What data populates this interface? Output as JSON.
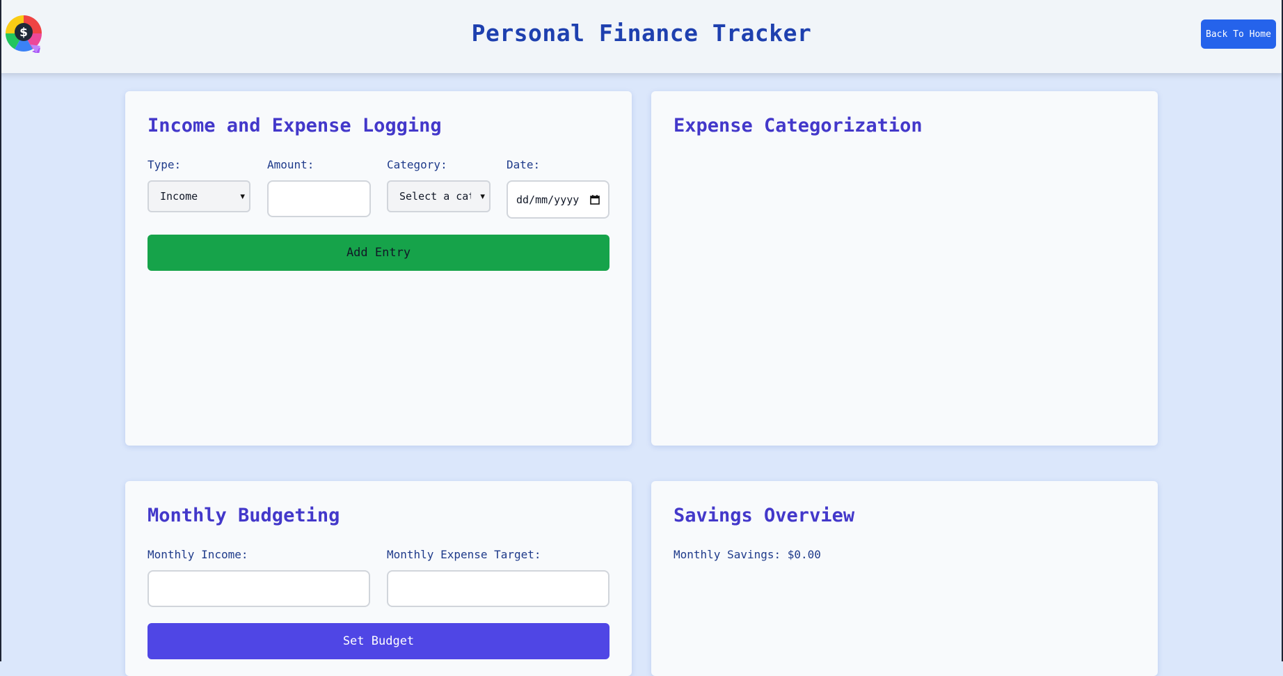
{
  "header": {
    "title": "Personal Finance Tracker",
    "back_label": "Back To Home",
    "logo_icon": "dollar-pie-logo-icon",
    "colors": {
      "title": "#1e40af",
      "back_button": "#2563eb"
    }
  },
  "logging": {
    "title": "Income and Expense Logging",
    "type_label": "Type:",
    "type_value": "Income",
    "amount_label": "Amount:",
    "amount_value": "",
    "category_label": "Category:",
    "category_value": "Select a category",
    "date_label": "Date:",
    "date_placeholder": "dd/mm/yyyy",
    "add_button": "Add Entry",
    "colors": {
      "add_button": "#16a34a"
    }
  },
  "categorization": {
    "title": "Expense Categorization"
  },
  "budgeting": {
    "title": "Monthly Budgeting",
    "income_label": "Monthly Income:",
    "income_value": "",
    "expense_label": "Monthly Expense Target:",
    "expense_value": "",
    "set_button": "Set Budget",
    "colors": {
      "set_button": "#4f46e5"
    }
  },
  "savings": {
    "title": "Savings Overview",
    "label": "Monthly Savings:",
    "value": "$0.00"
  }
}
